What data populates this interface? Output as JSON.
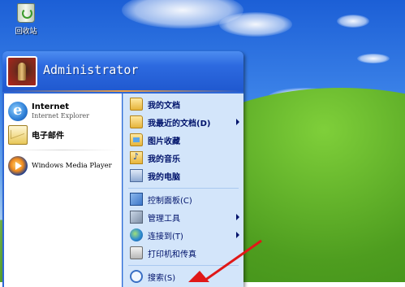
{
  "desktop": {
    "recycle_bin_label": "回收站"
  },
  "start_menu": {
    "user_name": "Administrator",
    "pinned": [
      {
        "title": "Internet",
        "subtitle": "Internet Explorer",
        "icon": "internet-explorer-icon"
      },
      {
        "title": "电子邮件",
        "subtitle": "",
        "icon": "email-icon"
      }
    ],
    "recent": [
      {
        "title": "Windows Media Player",
        "icon": "windows-media-player-icon"
      }
    ],
    "places": [
      {
        "label": "我的文档",
        "icon": "my-documents-icon",
        "bold": true,
        "submenu": false
      },
      {
        "label": "我最近的文档(D)",
        "icon": "recent-documents-icon",
        "bold": true,
        "submenu": true
      },
      {
        "label": "图片收藏",
        "icon": "my-pictures-icon",
        "bold": true,
        "submenu": false
      },
      {
        "label": "我的音乐",
        "icon": "my-music-icon",
        "bold": true,
        "submenu": false
      },
      {
        "label": "我的电脑",
        "icon": "my-computer-icon",
        "bold": true,
        "submenu": false
      }
    ],
    "system": [
      {
        "label": "控制面板(C)",
        "icon": "control-panel-icon",
        "submenu": false
      },
      {
        "label": "管理工具",
        "icon": "admin-tools-icon",
        "submenu": true
      },
      {
        "label": "连接到(T)",
        "icon": "connect-to-icon",
        "submenu": true
      },
      {
        "label": "打印机和传真",
        "icon": "printers-faxes-icon",
        "submenu": false
      }
    ],
    "search_label": "搜索(S)"
  },
  "colors": {
    "start_menu_blue": "#2f68d6",
    "right_pane": "#d3e5fa",
    "menu_text": "#00136b",
    "annotation_red": "#e01818"
  }
}
